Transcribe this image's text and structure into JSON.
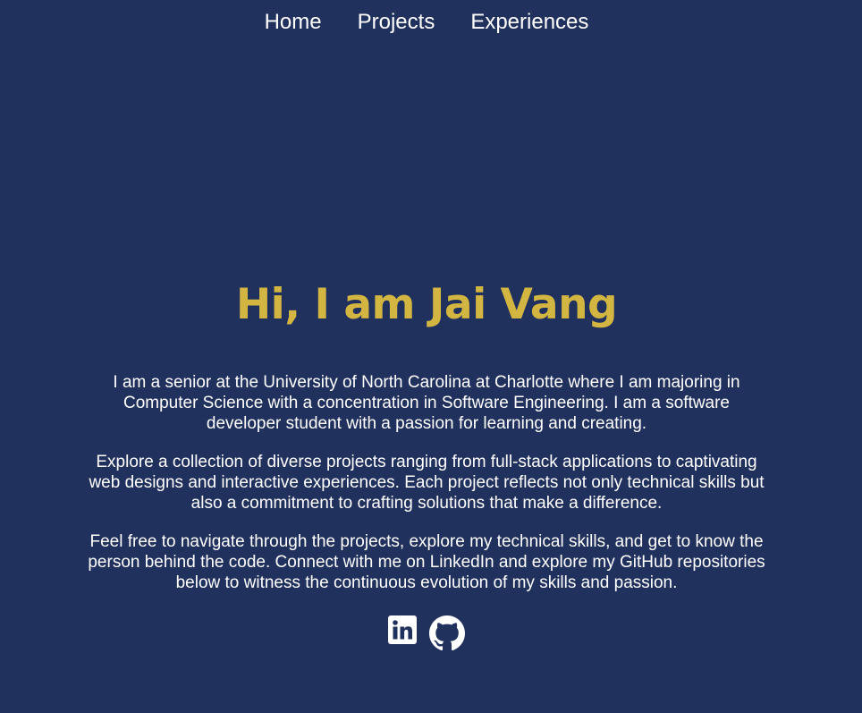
{
  "nav": {
    "items": [
      "Home",
      "Projects",
      "Experiences"
    ]
  },
  "hero": {
    "title": "Hi, I am Jai Vang"
  },
  "bio": {
    "paragraphs": [
      "I am a senior at the University of North Carolina at Charlotte where I am majoring in Computer Science with a concentration in Software Engineering. I am a software developer student with a passion for learning and creating.",
      "Explore a collection of diverse projects ranging from full-stack applications to captivating web designs and interactive experiences. Each project reflects not only technical skills but also a commitment to crafting solutions that make a difference.",
      "Feel free to navigate through the projects, explore my technical skills, and get to know the person behind the code. Connect with me on LinkedIn and explore my GitHub repositories below to witness the continuous evolution of my skills and passion."
    ]
  },
  "socials": [
    {
      "icon": "linkedin-icon"
    },
    {
      "icon": "github-icon"
    }
  ],
  "colors": {
    "background": "#21315d",
    "accent": "#d3b541",
    "text": "#ffffff"
  }
}
